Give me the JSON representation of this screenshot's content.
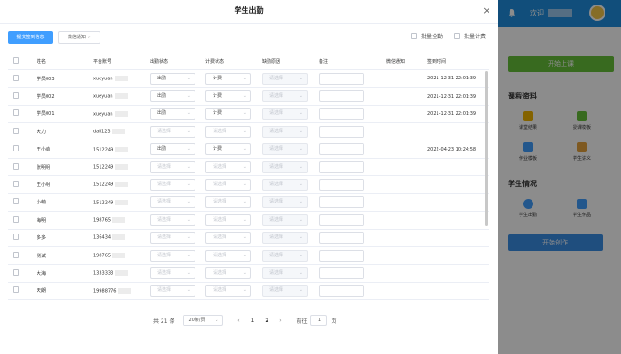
{
  "background": {
    "welcome": "欢迎",
    "start_class": "开始上课",
    "course_materials_title": "课程资料",
    "tiles": [
      {
        "label": "课堂结果",
        "icon": "certificate-icon",
        "color": "#f0b400"
      },
      {
        "label": "授课模板",
        "icon": "document-icon",
        "color": "#67c23a"
      },
      {
        "label": "作业模板",
        "icon": "file-icon",
        "color": "#409eff"
      },
      {
        "label": "学生讲义",
        "icon": "handout-icon",
        "color": "#e6a23c"
      }
    ],
    "student_info_title": "学生情况",
    "tiles2": [
      {
        "label": "学生出勤",
        "icon": "user-icon",
        "color": "#409eff"
      },
      {
        "label": "学生作品",
        "icon": "grid-icon",
        "color": "#409eff"
      }
    ],
    "start_create": "开始创作"
  },
  "dialog": {
    "title": "学生出勤",
    "close_symbol": "×",
    "update_button": "提交签到信息",
    "wechat_button": "微信通知",
    "wechat_button_icon": "send-icon",
    "batch_all_label": "批量全勤",
    "batch_fee_label": "批量计费"
  },
  "table": {
    "headers": [
      "姓名",
      "平台账号",
      "出勤状态",
      "计费状态",
      "缺勤原因",
      "备注",
      "微信通知",
      "签到时间"
    ],
    "rows": [
      {
        "name": "学员003",
        "account": "xueyuan",
        "attendance": "出勤",
        "fee": "计费",
        "reason": "请选择",
        "time": "2021-12-31 22:01:39"
      },
      {
        "name": "学员002",
        "account": "xueyuan",
        "attendance": "出勤",
        "fee": "计费",
        "reason": "请选择",
        "time": "2021-12-31 22:01:39"
      },
      {
        "name": "学员001",
        "account": "xueyuan",
        "attendance": "出勤",
        "fee": "计费",
        "reason": "请选择",
        "time": "2021-12-31 22:01:39"
      },
      {
        "name": "大力",
        "account": "dali123",
        "attendance": "请选择",
        "fee": "请选择",
        "reason": "请选择",
        "time": ""
      },
      {
        "name": "王小萌",
        "account": "1512249",
        "attendance": "出勤",
        "fee": "计费",
        "reason": "请选择",
        "time": "2022-04-23 10:24:58"
      },
      {
        "name": "张明明",
        "account": "1512249",
        "attendance": "请选择",
        "fee": "请选择",
        "reason": "请选择",
        "time": ""
      },
      {
        "name": "王小明",
        "account": "1512249",
        "attendance": "请选择",
        "fee": "请选择",
        "reason": "请选择",
        "time": ""
      },
      {
        "name": "小萌",
        "account": "1512249",
        "attendance": "请选择",
        "fee": "请选择",
        "reason": "请选择",
        "time": ""
      },
      {
        "name": "海明",
        "account": "198765",
        "attendance": "请选择",
        "fee": "请选择",
        "reason": "请选择",
        "time": ""
      },
      {
        "name": "多多",
        "account": "136434",
        "attendance": "请选择",
        "fee": "请选择",
        "reason": "请选择",
        "time": ""
      },
      {
        "name": "测试",
        "account": "198765",
        "attendance": "请选择",
        "fee": "请选择",
        "reason": "请选择",
        "time": ""
      },
      {
        "name": "大海",
        "account": "1333333",
        "attendance": "请选择",
        "fee": "请选择",
        "reason": "请选择",
        "time": ""
      },
      {
        "name": "天朗",
        "account": "19988776",
        "attendance": "请选择",
        "fee": "请选择",
        "reason": "请选择",
        "time": ""
      }
    ]
  },
  "pagination": {
    "total": "共 21 条",
    "page_size": "20条/页",
    "prev": "‹",
    "pages": [
      "1",
      "2"
    ],
    "current_page": "2",
    "next": "›",
    "goto_label": "前往",
    "goto_value": "1",
    "page_suffix": "页"
  }
}
